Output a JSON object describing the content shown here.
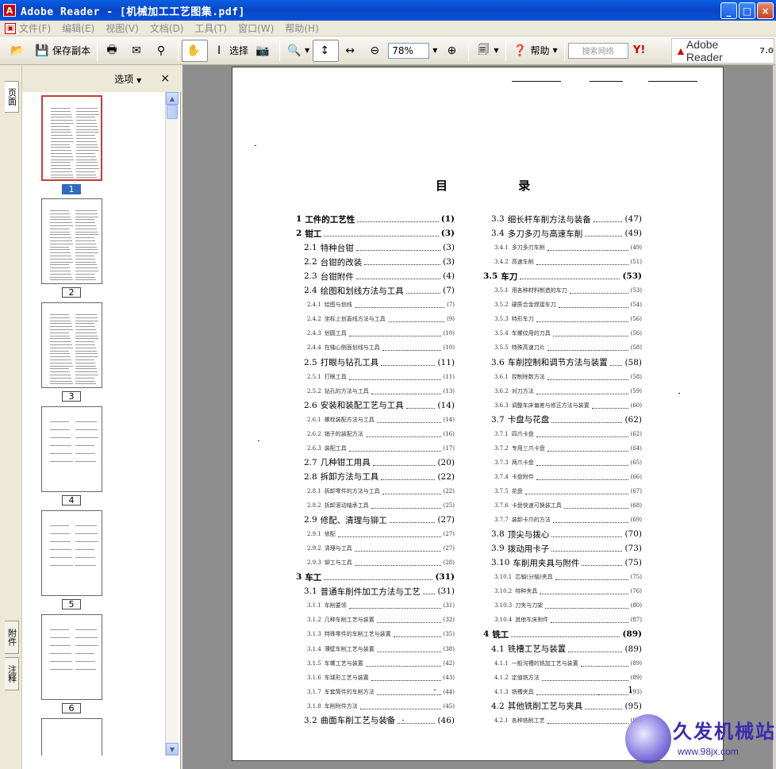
{
  "window": {
    "title": "Adobe Reader - [机械加工工艺图集.pdf]",
    "controls": [
      "_",
      "□",
      "×"
    ]
  },
  "menu": [
    "文件(F)",
    "编辑(E)",
    "视图(V)",
    "文档(D)",
    "工具(T)",
    "窗口(W)",
    "帮助(H)"
  ],
  "toolbar": {
    "save_copy": "保存副本",
    "select": "选择",
    "zoom": "78%",
    "help": "帮助",
    "search_placeholder": "搜索网络",
    "brand": "Adobe Reader",
    "brand_version": "7.0"
  },
  "sidebar": {
    "tabs": [
      "页面",
      "附件",
      "注释"
    ],
    "options": "选项",
    "close": "×",
    "pages": [
      "1",
      "2",
      "3",
      "4",
      "5",
      "6"
    ],
    "selected_page": "1"
  },
  "document": {
    "toc_title": "目 录",
    "page_number": "1",
    "left_column": [
      {
        "level": 1,
        "num": "1",
        "title": "工件的工艺性",
        "page": "(1)"
      },
      {
        "level": 1,
        "num": "2",
        "title": "钳工",
        "page": "(3)"
      },
      {
        "level": 2,
        "num": "2.1",
        "title": "特种台钳",
        "page": "(3)"
      },
      {
        "level": 2,
        "num": "2.2",
        "title": "台钳的改装",
        "page": "(3)"
      },
      {
        "level": 2,
        "num": "2.3",
        "title": "台钳附件",
        "page": "(4)"
      },
      {
        "level": 2,
        "num": "2.4",
        "title": "绘图和划线方法与工具",
        "page": "(7)"
      },
      {
        "level": 3,
        "num": "2.4.1",
        "title": "绘图与划线",
        "page": "(7)"
      },
      {
        "level": 3,
        "num": "2.4.2",
        "title": "坐标上划直线方法与工具",
        "page": "(9)"
      },
      {
        "level": 3,
        "num": "2.4.3",
        "title": "划圆工具",
        "page": "(10)"
      },
      {
        "level": 3,
        "num": "2.4.4",
        "title": "在轴心侧面划线与工具",
        "page": "(10)"
      },
      {
        "level": 2,
        "num": "2.5",
        "title": "打眼与钻孔工具",
        "page": "(11)"
      },
      {
        "level": 3,
        "num": "2.5.1",
        "title": "打眼工具",
        "page": "(11)"
      },
      {
        "level": 3,
        "num": "2.5.2",
        "title": "钻孔的方法与工具",
        "page": "(13)"
      },
      {
        "level": 2,
        "num": "2.6",
        "title": "安装和装配工艺与工具",
        "page": "(14)"
      },
      {
        "level": 3,
        "num": "2.6.1",
        "title": "螺栓装配方法与工具",
        "page": "(14)"
      },
      {
        "level": 3,
        "num": "2.6.2",
        "title": "销子的装配方法",
        "page": "(16)"
      },
      {
        "level": 3,
        "num": "2.6.3",
        "title": "装配工具",
        "page": "(17)"
      },
      {
        "level": 2,
        "num": "2.7",
        "title": "几种钳工用具",
        "page": "(20)"
      },
      {
        "level": 2,
        "num": "2.8",
        "title": "拆卸方法与工具",
        "page": "(22)"
      },
      {
        "level": 3,
        "num": "2.8.1",
        "title": "拆卸零件的方法与工具",
        "page": "(22)"
      },
      {
        "level": 3,
        "num": "2.8.2",
        "title": "拆卸滚动轴承工具",
        "page": "(25)"
      },
      {
        "level": 2,
        "num": "2.9",
        "title": "修配、清理与铆工",
        "page": "(27)"
      },
      {
        "level": 3,
        "num": "2.9.1",
        "title": "修配",
        "page": "(27)"
      },
      {
        "level": 3,
        "num": "2.9.2",
        "title": "清理与工具",
        "page": "(27)"
      },
      {
        "level": 3,
        "num": "2.9.3",
        "title": "铆工与工具",
        "page": "(28)"
      },
      {
        "level": 1,
        "num": "3",
        "title": "车工",
        "page": "(31)"
      },
      {
        "level": 2,
        "num": "3.1",
        "title": "普通车削件加工方法与工艺",
        "page": "(31)"
      },
      {
        "level": 3,
        "num": "3.1.1",
        "title": "车削要领",
        "page": "(31)"
      },
      {
        "level": 3,
        "num": "3.1.2",
        "title": "几种车削工艺与装置",
        "page": "(32)"
      },
      {
        "level": 3,
        "num": "3.1.3",
        "title": "特殊零件的车削工艺与装置",
        "page": "(35)"
      },
      {
        "level": 3,
        "num": "3.1.4",
        "title": "薄壁车削工艺与装置",
        "page": "(38)"
      },
      {
        "level": 3,
        "num": "3.1.5",
        "title": "车螺工艺与装置",
        "page": "(42)"
      },
      {
        "level": 3,
        "num": "3.1.6",
        "title": "车球形工艺与装置",
        "page": "(43)"
      },
      {
        "level": 3,
        "num": "3.1.7",
        "title": "车套筒件的车削方法",
        "page": "(44)"
      },
      {
        "level": 3,
        "num": "3.1.8",
        "title": "车削附件方法",
        "page": "(45)"
      },
      {
        "level": 2,
        "num": "3.2",
        "title": "曲面车削工艺与装备",
        "page": "(46)"
      }
    ],
    "right_column": [
      {
        "level": 2,
        "num": "3.3",
        "title": "细长杆车削方法与装备",
        "page": "(47)"
      },
      {
        "level": 2,
        "num": "3.4",
        "title": "多刀多刃与高速车削",
        "page": "(49)"
      },
      {
        "level": 3,
        "num": "3.4.1",
        "title": "多刀多刃车削",
        "page": "(49)"
      },
      {
        "level": 3,
        "num": "3.4.2",
        "title": "高速车削",
        "page": "(51)"
      },
      {
        "level": 1,
        "num": "3.5",
        "title": "车刀",
        "page": "(53)"
      },
      {
        "level": 3,
        "num": "3.5.1",
        "title": "用各种材料制造的车刀",
        "page": "(53)"
      },
      {
        "level": 3,
        "num": "3.5.2",
        "title": "硬质合金焊接车刀",
        "page": "(54)"
      },
      {
        "level": 3,
        "num": "3.5.3",
        "title": "特形车刀",
        "page": "(56)"
      },
      {
        "level": 3,
        "num": "3.5.4",
        "title": "车螺纹用的刀具",
        "page": "(56)"
      },
      {
        "level": 3,
        "num": "3.5.5",
        "title": "特殊高速刀片",
        "page": "(58)"
      },
      {
        "level": 2,
        "num": "3.6",
        "title": "车削控制和调节方法与装置",
        "page": "(58)"
      },
      {
        "level": 3,
        "num": "3.6.1",
        "title": "控制除数方法",
        "page": "(58)"
      },
      {
        "level": 3,
        "num": "3.6.2",
        "title": "对刀方法",
        "page": "(59)"
      },
      {
        "level": 3,
        "num": "3.6.3",
        "title": "调整车床偏差与修正方法与装置",
        "page": "(60)"
      },
      {
        "level": 2,
        "num": "3.7",
        "title": "卡盘与花盘",
        "page": "(62)"
      },
      {
        "level": 3,
        "num": "3.7.1",
        "title": "四爪卡盘",
        "page": "(62)"
      },
      {
        "level": 3,
        "num": "3.7.2",
        "title": "专用三爪卡盘",
        "page": "(64)"
      },
      {
        "level": 3,
        "num": "3.7.3",
        "title": "两爪卡盘",
        "page": "(65)"
      },
      {
        "level": 3,
        "num": "3.7.4",
        "title": "卡盘附件",
        "page": "(66)"
      },
      {
        "level": 3,
        "num": "3.7.5",
        "title": "花盘",
        "page": "(67)"
      },
      {
        "level": 3,
        "num": "3.7.6",
        "title": "卡盘快速可换装工具",
        "page": "(68)"
      },
      {
        "level": 3,
        "num": "3.7.7",
        "title": "装卸卡爪的方法",
        "page": "(69)"
      },
      {
        "level": 2,
        "num": "3.8",
        "title": "顶尖与拨心",
        "page": "(70)"
      },
      {
        "level": 2,
        "num": "3.9",
        "title": "拨动用卡子",
        "page": "(73)"
      },
      {
        "level": 2,
        "num": "3.10",
        "title": "车削用夹具与附件",
        "page": "(75)"
      },
      {
        "level": 3,
        "num": "3.10.1",
        "title": "芯轴(分轴)夹具",
        "page": "(75)"
      },
      {
        "level": 3,
        "num": "3.10.2",
        "title": "特种夹具",
        "page": "(76)"
      },
      {
        "level": 3,
        "num": "3.10.3",
        "title": "刀夹与刀架",
        "page": "(80)"
      },
      {
        "level": 3,
        "num": "3.10.4",
        "title": "其他车床附件",
        "page": "(87)"
      },
      {
        "level": 1,
        "num": "4",
        "title": "铣工",
        "page": "(89)"
      },
      {
        "level": 2,
        "num": "4.1",
        "title": "铣槽工艺与装置",
        "page": "(89)"
      },
      {
        "level": 3,
        "num": "4.1.1",
        "title": "一般沟槽的铣加工艺与装置",
        "page": "(89)"
      },
      {
        "level": 3,
        "num": "4.1.2",
        "title": "定值铣方法",
        "page": "(89)"
      },
      {
        "level": 3,
        "num": "4.1.3",
        "title": "铣槽夹具",
        "page": "(93)"
      },
      {
        "level": 2,
        "num": "4.2",
        "title": "其他铣削工艺与夹具",
        "page": "(95)"
      },
      {
        "level": 3,
        "num": "4.2.1",
        "title": "各种铣削工艺",
        "page": "(95)"
      }
    ]
  },
  "watermark": {
    "name": "久发机械站",
    "url": "www.98jx.com"
  }
}
